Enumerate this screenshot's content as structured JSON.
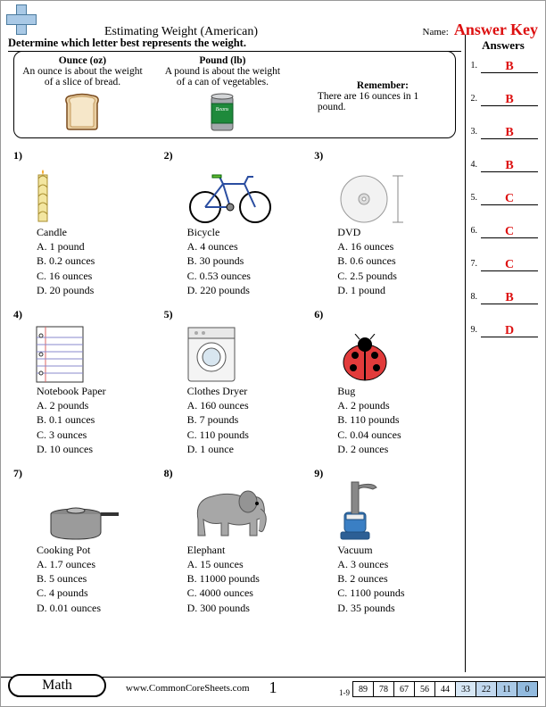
{
  "header": {
    "title": "Estimating Weight (American)",
    "name_label": "Name:",
    "name_value": "Answer Key",
    "instruction": "Determine which letter best represents the weight."
  },
  "legend": {
    "ounce_title": "Ounce (oz)",
    "ounce_desc": "An ounce is about the weight of a slice of bread.",
    "pound_title": "Pound (lb)",
    "pound_desc": "A pound is about the weight of a can of vegetables.",
    "remember_title": "Remember:",
    "remember_text": "There are 16 ounces in 1 pound."
  },
  "questions": [
    {
      "n": "1)",
      "name": "Candle",
      "opts": [
        "A. 1 pound",
        "B. 0.2 ounces",
        "C. 16 ounces",
        "D. 20 pounds"
      ]
    },
    {
      "n": "2)",
      "name": "Bicycle",
      "opts": [
        "A. 4 ounces",
        "B. 30 pounds",
        "C. 0.53 ounces",
        "D. 220 pounds"
      ]
    },
    {
      "n": "3)",
      "name": "DVD",
      "opts": [
        "A. 16 ounces",
        "B. 0.6 ounces",
        "C. 2.5 pounds",
        "D. 1 pound"
      ]
    },
    {
      "n": "4)",
      "name": "Notebook Paper",
      "opts": [
        "A. 2 pounds",
        "B. 0.1 ounces",
        "C. 3 ounces",
        "D. 10 ounces"
      ]
    },
    {
      "n": "5)",
      "name": "Clothes Dryer",
      "opts": [
        "A. 160 ounces",
        "B. 7 pounds",
        "C. 110 pounds",
        "D. 1 ounce"
      ]
    },
    {
      "n": "6)",
      "name": "Bug",
      "opts": [
        "A. 2 pounds",
        "B. 110 pounds",
        "C. 0.04 ounces",
        "D. 2 ounces"
      ]
    },
    {
      "n": "7)",
      "name": "Cooking Pot",
      "opts": [
        "A. 1.7 ounces",
        "B. 5 ounces",
        "C. 4 pounds",
        "D. 0.01 ounces"
      ]
    },
    {
      "n": "8)",
      "name": "Elephant",
      "opts": [
        "A. 15 ounces",
        "B. 11000 pounds",
        "C. 4000 ounces",
        "D. 300 pounds"
      ]
    },
    {
      "n": "9)",
      "name": "Vacuum",
      "opts": [
        "A. 3 ounces",
        "B. 2 ounces",
        "C. 1100 pounds",
        "D. 35 pounds"
      ]
    }
  ],
  "answers_header": "Answers",
  "answers": [
    {
      "n": "1.",
      "v": "B"
    },
    {
      "n": "2.",
      "v": "B"
    },
    {
      "n": "3.",
      "v": "B"
    },
    {
      "n": "4.",
      "v": "B"
    },
    {
      "n": "5.",
      "v": "C"
    },
    {
      "n": "6.",
      "v": "C"
    },
    {
      "n": "7.",
      "v": "C"
    },
    {
      "n": "8.",
      "v": "B"
    },
    {
      "n": "9.",
      "v": "D"
    }
  ],
  "footer": {
    "subject": "Math",
    "site": "www.CommonCoreSheets.com",
    "page_number": "1",
    "score_label": "1-9",
    "score_values": [
      "89",
      "78",
      "67",
      "56",
      "44",
      "33",
      "22",
      "11",
      "0"
    ]
  }
}
